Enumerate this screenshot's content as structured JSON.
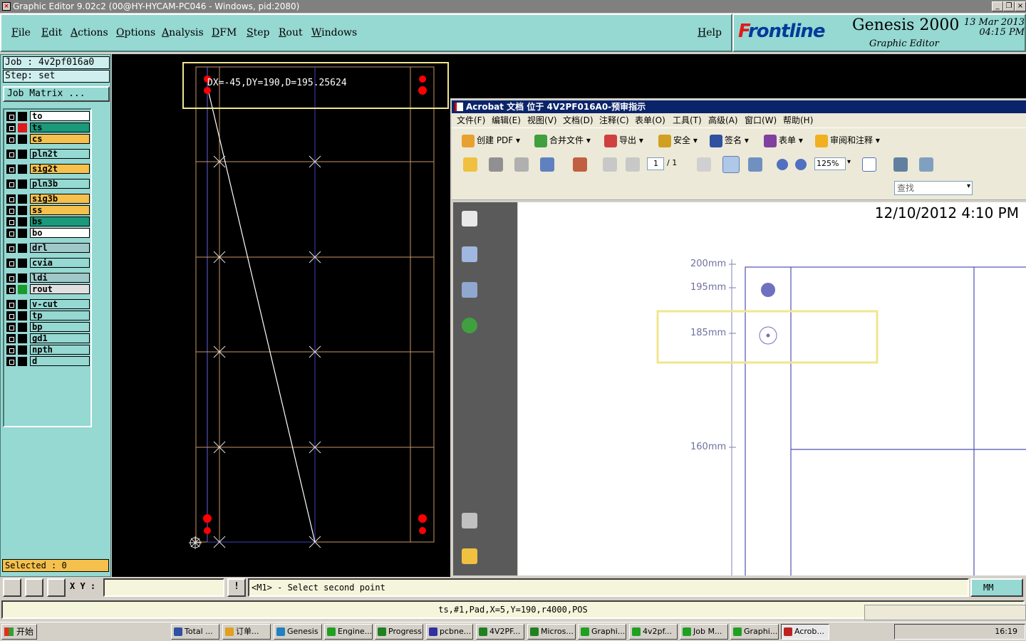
{
  "window": {
    "title": "Graphic Editor 9.02c2 (00@HY-HYCAM-PC046 - Windows, pid:2080)"
  },
  "menu": [
    "File",
    "Edit",
    "Actions",
    "Options",
    "Analysis",
    "DFM",
    "Step",
    "Rout",
    "Windows"
  ],
  "help": "Help",
  "brand": {
    "logo_f": "F",
    "logo_rest": "rontline",
    "product": "Genesis 2000",
    "subtitle": "Graphic Editor",
    "date": "13 Mar 2013",
    "time": "04:15 PM"
  },
  "job": {
    "job_line": "Job : 4v2pf016a0",
    "step_line": "Step: set",
    "matrix_button": "Job Matrix ..."
  },
  "layers": [
    {
      "name": "to",
      "color": "#ffffff",
      "ind": "#000000"
    },
    {
      "name": "ts",
      "color": "#1a9a7a",
      "ind": "#e01a1a"
    },
    {
      "name": "cs",
      "color": "#f5c04b",
      "ind": "#000000"
    },
    {
      "name": "pln2t",
      "color": "#96d8d2",
      "ind": "#000000"
    },
    {
      "name": "sig2t",
      "color": "#f5c04b",
      "ind": "#000000"
    },
    {
      "name": "pln3b",
      "color": "#96d8d2",
      "ind": "#000000"
    },
    {
      "name": "sig3b",
      "color": "#f5c04b",
      "ind": "#000000"
    },
    {
      "name": "ss",
      "color": "#f5c04b",
      "ind": "#000000"
    },
    {
      "name": "bs",
      "color": "#1a9a7a",
      "ind": "#000000"
    },
    {
      "name": "bo",
      "color": "#ffffff",
      "ind": "#000000"
    },
    {
      "name": "drl",
      "color": "#a0c8c8",
      "ind": "#000000"
    },
    {
      "name": "cvia",
      "color": "#96d8d2",
      "ind": "#000000"
    },
    {
      "name": "ldi",
      "color": "#a0c8c8",
      "ind": "#000000"
    },
    {
      "name": "rout",
      "color": "#e0e0e0",
      "ind": "#1a9a2a"
    },
    {
      "name": "v-cut",
      "color": "#96d8d2",
      "ind": "#000000"
    },
    {
      "name": "tp",
      "color": "#96d8d2",
      "ind": "#000000"
    },
    {
      "name": "bp",
      "color": "#96d8d2",
      "ind": "#000000"
    },
    {
      "name": "gd1",
      "color": "#96d8d2",
      "ind": "#000000"
    },
    {
      "name": "npth",
      "color": "#96d8d2",
      "ind": "#000000"
    },
    {
      "name": "d",
      "color": "#96d8d2",
      "ind": "#000000"
    }
  ],
  "selected": "Selected : 0",
  "measure": "DX=-45,DY=190,D=195.25624",
  "acrobat": {
    "title": "Acrobat 文档 位于 4V2PF016A0-预审指示",
    "menu": [
      "文件(F)",
      "编辑(E)",
      "视图(V)",
      "文档(D)",
      "注释(C)",
      "表单(O)",
      "工具(T)",
      "高级(A)",
      "窗口(W)",
      "帮助(H)"
    ],
    "toolbar1": [
      "创建 PDF",
      "合并文件",
      "导出",
      "安全",
      "签名",
      "表单",
      "审阅和注释"
    ],
    "page_current": "1",
    "page_total": "/ 1",
    "zoom": "125%",
    "find_placeholder": "查找",
    "doc_timestamp": "12/10/2012 4:10 PM",
    "ruler": [
      "200mm",
      "195mm",
      "185mm",
      "160mm"
    ]
  },
  "status": {
    "xy_label": "X Y :",
    "prompt": "<M1> - Select second point",
    "units": "MM",
    "info": "ts,#1,Pad,X=5,Y=190,r4000,POS"
  },
  "taskbar": {
    "start": "开始",
    "tasks": [
      "Total ...",
      "订单...",
      "Genesis",
      "Engine...",
      "Progress",
      "pcbne...",
      "4V2PF...",
      "Micros...",
      "Graphi...",
      "4v2pf...",
      "Job M...",
      "Graphi...",
      "Acrob..."
    ],
    "clock": "16:19"
  },
  "colors": {
    "panel": "#96d8d2",
    "highlight_yellow": "#f0e68c",
    "pad_red": "#ff0000",
    "profile_orange": "#c8966a",
    "route_blue": "#4040c0"
  }
}
